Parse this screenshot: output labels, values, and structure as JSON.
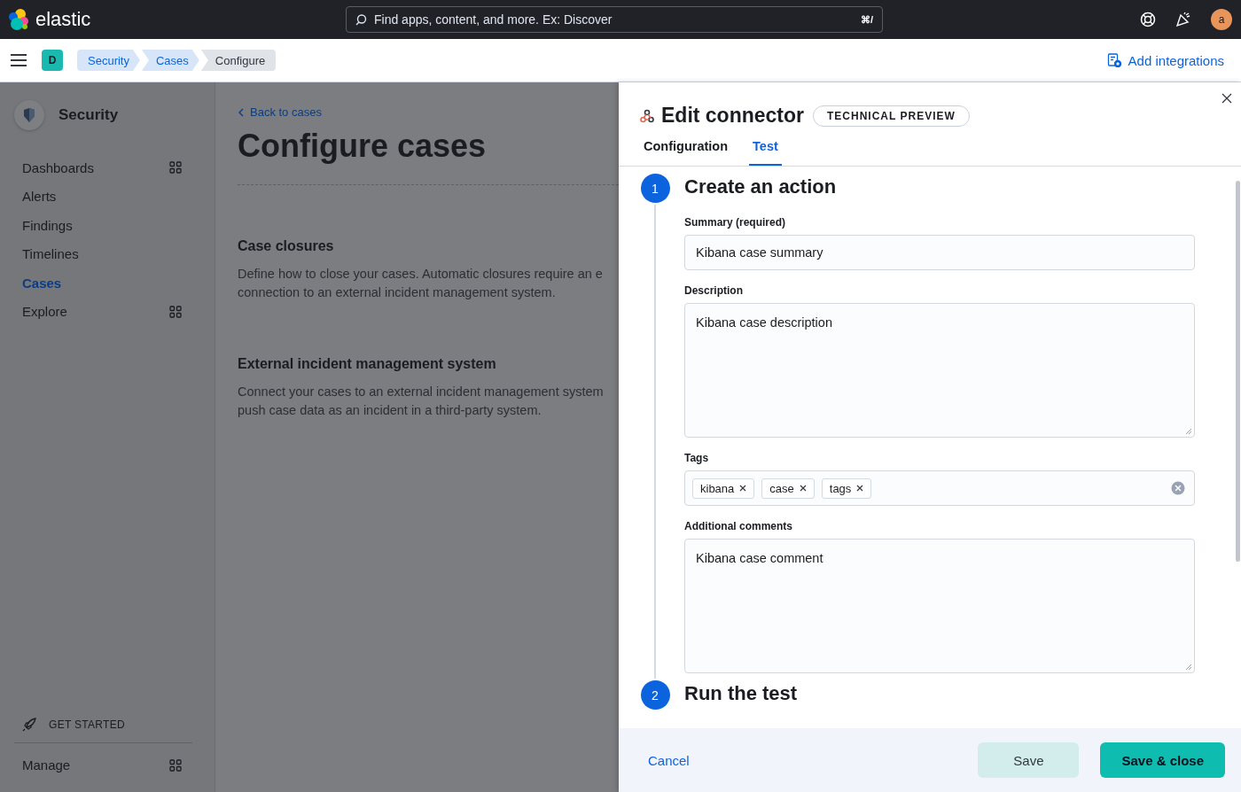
{
  "header": {
    "logo": "elastic",
    "search": {
      "placeholder": "Find apps, content, and more. Ex: Discover",
      "shortcut": "⌘/"
    },
    "avatar": "a"
  },
  "nav": {
    "space": "D",
    "breadcrumbs": [
      {
        "label": "Security",
        "selected": false
      },
      {
        "label": "Cases",
        "selected": false
      },
      {
        "label": "Configure",
        "selected": true
      }
    ],
    "add_integrations": "Add integrations"
  },
  "sidebar": {
    "title": "Security",
    "items": [
      {
        "label": "Dashboards",
        "selected": false,
        "kind": "group"
      },
      {
        "label": "Alerts",
        "selected": false,
        "kind": "link"
      },
      {
        "label": "Findings",
        "selected": false,
        "kind": "link"
      },
      {
        "label": "Timelines",
        "selected": false,
        "kind": "link"
      },
      {
        "label": "Cases",
        "selected": true,
        "kind": "link"
      },
      {
        "label": "Explore",
        "selected": false,
        "kind": "group"
      }
    ],
    "get_started": "GET STARTED",
    "manage": "Manage"
  },
  "page": {
    "back_link": "Back to cases",
    "title": "Configure cases",
    "sections": [
      {
        "heading": "Case closures",
        "text": "Define how to close your cases. Automatic closures require an e\nconnection to an external incident management system."
      },
      {
        "heading": "External incident management system",
        "text": "Connect your cases to an external incident management system\npush case data as an incident in a third-party system."
      }
    ]
  },
  "flyout": {
    "title": "Edit connector",
    "badge": "TECHNICAL PREVIEW",
    "tabs": [
      {
        "label": "Configuration",
        "selected": false
      },
      {
        "label": "Test",
        "selected": true
      }
    ],
    "steps": [
      {
        "number": "1",
        "title": "Create an action",
        "fields": [
          {
            "kind": "input",
            "label": "Summary (required)",
            "value": "Kibana case summary"
          },
          {
            "kind": "textarea",
            "label": "Description",
            "value": "Kibana case description"
          },
          {
            "kind": "tags",
            "label": "Tags",
            "tags": [
              "kibana",
              "case",
              "tags"
            ]
          },
          {
            "kind": "textarea",
            "label": "Additional comments",
            "value": "Kibana case comment"
          }
        ]
      },
      {
        "number": "2",
        "title": "Run the test"
      }
    ],
    "footer": {
      "cancel": "Cancel",
      "save": {
        "label": "Save",
        "disabled": true
      },
      "save_close": "Save & close"
    }
  }
}
